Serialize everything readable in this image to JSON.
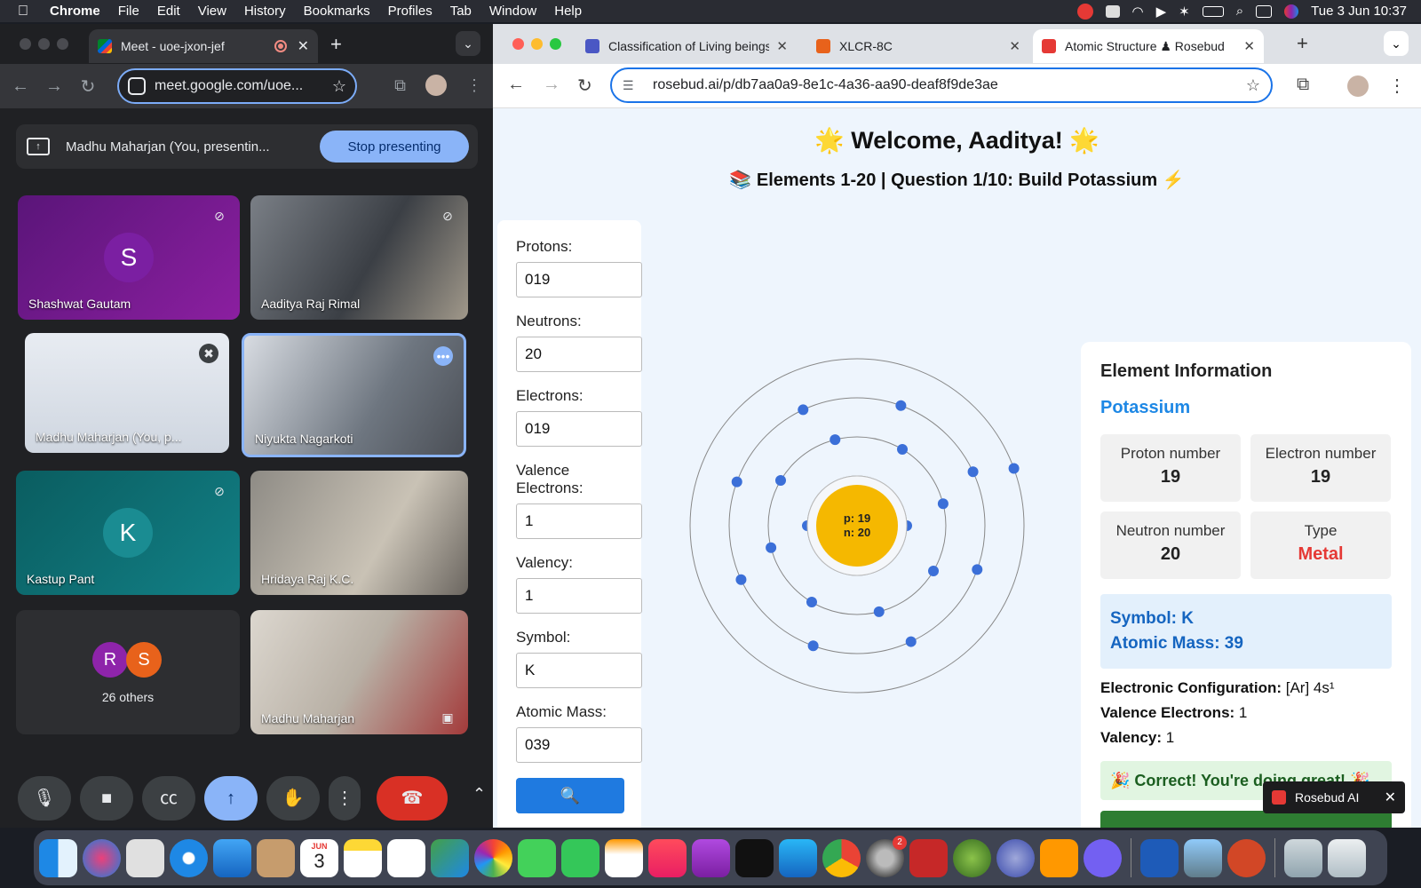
{
  "menubar": {
    "app": "Chrome",
    "items": [
      "File",
      "Edit",
      "View",
      "History",
      "Bookmarks",
      "Profiles",
      "Tab",
      "Window",
      "Help"
    ],
    "clock": "Tue 3 Jun  10:37"
  },
  "meet_window": {
    "tab_title": "Meet - uoe-jxon-jef",
    "url": "meet.google.com/uoe...",
    "presenting_text": "Madhu Maharjan (You, presentin...",
    "stop_presenting": "Stop presenting",
    "participants": [
      {
        "name": "Shashwat Gautam",
        "initial": "S"
      },
      {
        "name": "Aaditya Raj Rimal"
      },
      {
        "name": "Madhu Maharjan (You, p..."
      },
      {
        "name": "Niyukta Nagarkoti"
      },
      {
        "name": "Kastup Pant",
        "initial": "K"
      },
      {
        "name": "Hridaya Raj K.C."
      },
      {
        "name": "Madhu Maharjan"
      }
    ],
    "others": {
      "initials": [
        "R",
        "S"
      ],
      "label": "26 others"
    }
  },
  "rosebud_window": {
    "tabs": [
      {
        "title": "Classification of Living beings"
      },
      {
        "title": "XLCR-8C"
      },
      {
        "title": "Atomic Structure ♟ Rosebud"
      }
    ],
    "url": "rosebud.ai/p/db7aa0a9-8e1c-4a36-aa90-deaf8f9de3ae",
    "welcome": "🌟 Welcome, Aaditya! 🌟",
    "question": "📚 Elements 1-20 | Question 1/10: Build Potassium ⚡",
    "form": {
      "protons_label": "Protons:",
      "protons": "019",
      "neutrons_label": "Neutrons:",
      "neutrons": "20",
      "electrons_label": "Electrons:",
      "electrons": "019",
      "valence_label": "Valence Electrons:",
      "valence": "1",
      "valency_label": "Valency:",
      "valency": "1",
      "symbol_label": "Symbol:",
      "symbol": "K",
      "mass_label": "Atomic Mass:",
      "mass": "039",
      "check_icon": "🔍"
    },
    "nucleus": {
      "p": "p: 19",
      "n": "n: 20"
    },
    "shells": [
      2,
      8,
      8,
      1
    ],
    "info": {
      "title": "Element Information",
      "element": "Potassium",
      "proton_label": "Proton number",
      "proton_value": "19",
      "electron_label": "Electron number",
      "electron_value": "19",
      "neutron_label": "Neutron number",
      "neutron_value": "20",
      "type_label": "Type",
      "type_value": "Metal",
      "symbol_line": "Symbol: K",
      "mass_line": "Atomic Mass: 39",
      "config_label": "Electronic Configuration:",
      "config_value": "[Ar] 4s¹",
      "valence_label": "Valence Electrons:",
      "valence_value": "1",
      "valency_label": "Valency:",
      "valency_value": "1",
      "correct": "🎉 Correct! You're doing great! 🎉"
    },
    "badge": "Rosebud AI"
  },
  "dock": {
    "calendar_month": "JUN",
    "calendar_day": "3",
    "settings_badge": "2"
  },
  "colors": {
    "accent": "#1a73e8",
    "nucleus": "#f5b800",
    "electron": "#3b6fd8",
    "metal": "#e53935"
  }
}
